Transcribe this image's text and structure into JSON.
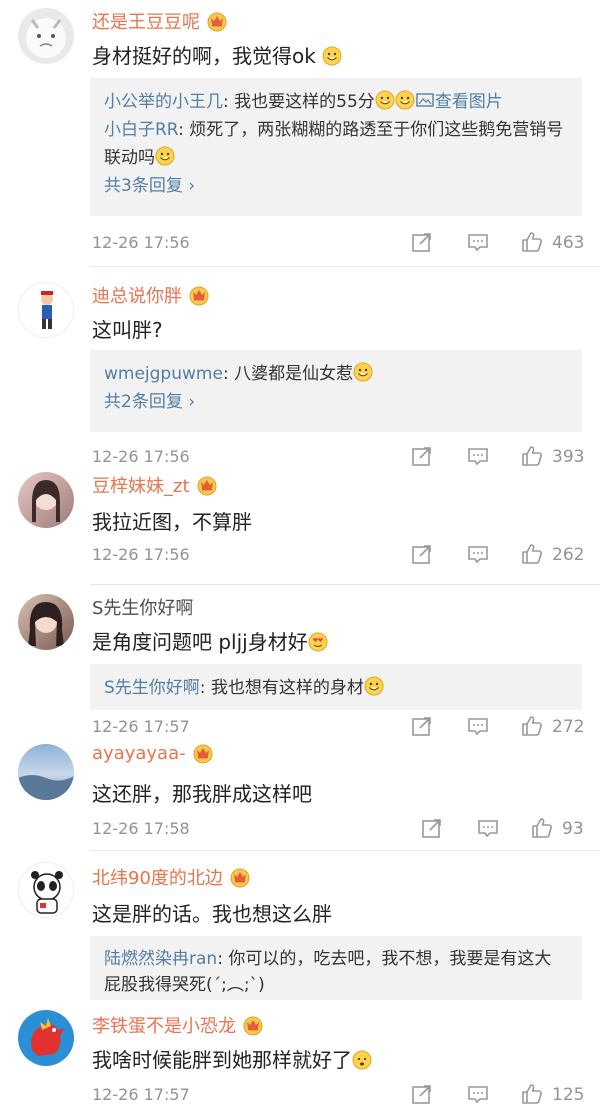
{
  "comments": [
    {
      "username": "还是王豆豆呢",
      "text": "身材挺好的啊，我觉得ok",
      "replies": [
        {
          "name": "小公举的小王几",
          "text": ": 我也要这样的55分",
          "extra": "查看图片"
        },
        {
          "name": "小白子RR",
          "text": ": 烦死了，两张糊糊的路透至于你们这些鹅免营销号联动吗"
        }
      ],
      "more": "共3条回复 ›",
      "time": "12-26 17:56",
      "likes": "463"
    },
    {
      "username": "迪总说你胖",
      "text": "这叫胖?",
      "replies": [
        {
          "name": "wmejgpuwme",
          "text": ": 八婆都是仙女惹"
        }
      ],
      "more": "共2条回复 ›",
      "time": "12-26 17:56",
      "likes": "393"
    },
    {
      "username": "豆梓妹妹_zt",
      "text": "我拉近图，不算胖",
      "time": "12-26 17:56",
      "likes": "262"
    },
    {
      "username": "S先生你好啊",
      "text": "是角度问题吧 pljj身材好",
      "replies": [
        {
          "name": "S先生你好啊",
          "text": ": 我也想有这样的身材"
        }
      ],
      "time": "12-26 17:57",
      "likes": "272"
    },
    {
      "username": "ayayayaa-",
      "text": "这还胖，那我胖成这样吧",
      "time": "12-26 17:58",
      "likes": "93"
    },
    {
      "username": "北纬90度的北边",
      "text": "这是胖的话。我也想这么胖",
      "replies": [
        {
          "name": "陆燃然染冉ran",
          "text": ": 你可以的，吃去吧，我不想，我要是有这大屁股我得哭死(´;︵;`)"
        }
      ]
    },
    {
      "username": "李铁蛋不是小恐龙",
      "text": "我啥时候能胖到她那样就好了",
      "time": "12-26 17:57",
      "likes": "125"
    }
  ],
  "colors": {
    "username": "#eb7350",
    "reply_name": "#537ea3",
    "meta": "#939393",
    "reply_bg": "#f2f2f2"
  }
}
